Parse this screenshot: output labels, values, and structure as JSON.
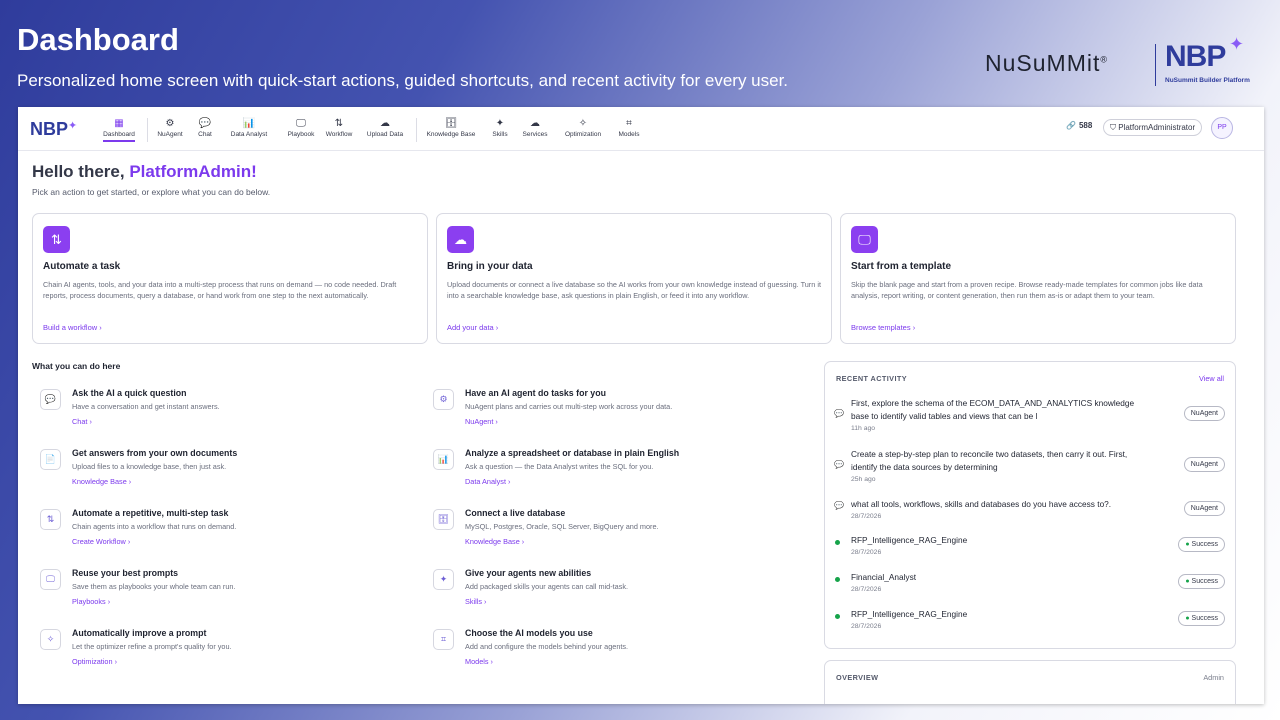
{
  "slide": {
    "title": "Dashboard",
    "subtitle": "Personalized home screen with quick-start actions, guided shortcuts, and recent activity for every user."
  },
  "brand": {
    "nusummit": "NuSuMMit",
    "registered": "®",
    "nbp": "NBP",
    "tagline": "NuSummit Builder Platform"
  },
  "colors": {
    "accent": "#7c3aed",
    "icon_tile": "#8b3ff0",
    "success": "#16a34a",
    "brand_blue": "#2f3c9c"
  },
  "app": {
    "logo": "NBP",
    "nav": [
      {
        "label": "Dashboard",
        "icon": "grid-icon",
        "glyph": "▦"
      },
      {
        "label": "NuAgent",
        "icon": "robot-icon",
        "glyph": "⚙"
      },
      {
        "label": "Chat",
        "icon": "chat-icon",
        "glyph": "💬"
      },
      {
        "label": "Data Analyst",
        "icon": "bar-chart-icon",
        "glyph": "📊"
      },
      {
        "label": "Playbook",
        "icon": "monitor-icon",
        "glyph": "🖵"
      },
      {
        "label": "Workflow",
        "icon": "workflow-icon",
        "glyph": "⇅"
      },
      {
        "label": "Upload Data",
        "icon": "cloud-upload-icon",
        "glyph": "☁"
      },
      {
        "label": "Knowledge Base",
        "icon": "database-icon",
        "glyph": "🗄"
      },
      {
        "label": "Skills",
        "icon": "sparkles-icon",
        "glyph": "✦"
      },
      {
        "label": "Services",
        "icon": "cloud-icon",
        "glyph": "☁"
      },
      {
        "label": "Optimization",
        "icon": "magic-wand-icon",
        "glyph": "✧"
      },
      {
        "label": "Models",
        "icon": "models-icon",
        "glyph": "⌗"
      }
    ],
    "credits": "588",
    "user": "PlatformAdministrator",
    "avatar": "PP",
    "greeting_prefix": "Hello there, ",
    "greeting_name": "PlatformAdmin!",
    "greeting_sub": "Pick an action to get started, or explore what you can do below.",
    "quick_cards": [
      {
        "icon": "workflow-icon",
        "glyph": "⇅",
        "title": "Automate a task",
        "desc": "Chain AI agents, tools, and your data into a multi-step process that runs on demand — no code needed. Draft reports, process documents, query a database, or hand work from one step to the next automatically.",
        "link": "Build a workflow  ›"
      },
      {
        "icon": "cloud-upload-icon",
        "glyph": "☁",
        "title": "Bring in your data",
        "desc": "Upload documents or connect a live database so the AI works from your own knowledge instead of guessing. Turn it into a searchable knowledge base, ask questions in plain English, or feed it into any workflow.",
        "link": "Add your data  ›"
      },
      {
        "icon": "monitor-icon",
        "glyph": "🖵",
        "title": "Start from a template",
        "desc": "Skip the blank page and start from a proven recipe. Browse ready-made templates for common jobs like data analysis, report writing, or content generation, then run them as-is or adapt them to your team.",
        "link": "Browse templates  ›"
      }
    ],
    "what_title": "What you can do here",
    "features": [
      {
        "icon": "chat-icon",
        "glyph": "💬",
        "title": "Ask the AI a quick question",
        "desc": "Have a conversation and get instant answers.",
        "link": "Chat  ›"
      },
      {
        "icon": "robot-icon",
        "glyph": "⚙",
        "title": "Have an AI agent do tasks for you",
        "desc": "NuAgent plans and carries out multi-step work across your data.",
        "link": "NuAgent  ›"
      },
      {
        "icon": "document-icon",
        "glyph": "📄",
        "title": "Get answers from your own documents",
        "desc": "Upload files to a knowledge base, then just ask.",
        "link": "Knowledge Base  ›"
      },
      {
        "icon": "bar-chart-icon",
        "glyph": "📊",
        "title": "Analyze a spreadsheet or database in plain English",
        "desc": "Ask a question — the Data Analyst writes the SQL for you.",
        "link": "Data Analyst  ›"
      },
      {
        "icon": "workflow-icon",
        "glyph": "⇅",
        "title": "Automate a repetitive, multi-step task",
        "desc": "Chain agents into a workflow that runs on demand.",
        "link": "Create Workflow  ›"
      },
      {
        "icon": "database-icon",
        "glyph": "🗄",
        "title": "Connect a live database",
        "desc": "MySQL, Postgres, Oracle, SQL Server, BigQuery and more.",
        "link": "Knowledge Base  ›"
      },
      {
        "icon": "monitor-icon",
        "glyph": "🖵",
        "title": "Reuse your best prompts",
        "desc": "Save them as playbooks your whole team can run.",
        "link": "Playbooks  ›"
      },
      {
        "icon": "sparkles-icon",
        "glyph": "✦",
        "title": "Give your agents new abilities",
        "desc": "Add packaged skills your agents can call mid-task.",
        "link": "Skills  ›"
      },
      {
        "icon": "magic-wand-icon",
        "glyph": "✧",
        "title": "Automatically improve a prompt",
        "desc": "Let the optimizer refine a prompt's quality for you.",
        "link": "Optimization  ›"
      },
      {
        "icon": "models-icon",
        "glyph": "⌗",
        "title": "Choose the AI models you use",
        "desc": "Add and configure the models behind your agents.",
        "link": "Models  ›"
      }
    ],
    "activity": {
      "title": "RECENT ACTIVITY",
      "view_all": "View all",
      "items": [
        {
          "kind": "chat",
          "text": "First, explore the schema of the ECOM_DATA_AND_ANALYTICS knowledge base to identify valid tables and views that can be l",
          "meta": "11h ago",
          "badge": "NuAgent"
        },
        {
          "kind": "chat",
          "text": "Create a step-by-step plan to reconcile two datasets, then carry it out. First, identify the data sources by determining",
          "meta": "25h ago",
          "badge": "NuAgent"
        },
        {
          "kind": "chat",
          "text": "what all tools, workflows, skills and databases do you have access to?.",
          "meta": "28/7/2026",
          "badge": "NuAgent"
        },
        {
          "kind": "run",
          "text": "RFP_Intelligence_RAG_Engine",
          "meta": "28/7/2026",
          "badge": "Success"
        },
        {
          "kind": "run",
          "text": "Financial_Analyst",
          "meta": "28/7/2026",
          "badge": "Success"
        },
        {
          "kind": "run",
          "text": "RFP_Intelligence_RAG_Engine",
          "meta": "28/7/2026",
          "badge": "Success"
        }
      ]
    },
    "overview": {
      "title": "OVERVIEW",
      "action": "Admin"
    }
  }
}
